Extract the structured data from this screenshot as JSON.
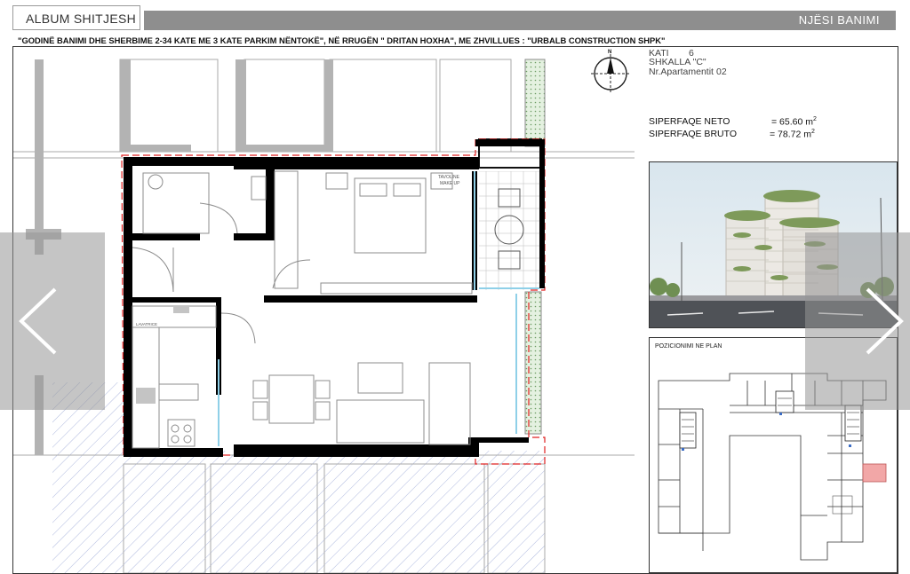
{
  "header": {
    "album_title": "ALBUM SHITJESH",
    "unit_title": "NJËSI BANIMI",
    "project_description": "\"GODINË BANIMI DHE SHERBIME 2-34 KATE  ME 3 KATE PARKIM NËNTOKË\", NË RRUGËN \" DRITAN HOXHA\", ME  ZHVILLUES : \"URBALB CONSTRUCTION SHPK\""
  },
  "apartment": {
    "floor_label": "KATI",
    "floor_value": "6",
    "stair_label": "SHKALLA \"C\"",
    "apartment_label": "Nr.Apartamentit",
    "apartment_value": "02"
  },
  "areas": {
    "net_label": "SIPERFAQE NETO",
    "net_value": "= 65.60 m",
    "gross_label": "SIPERFAQE BRUTO",
    "gross_value": "= 78.72 m",
    "unit_sup": "2"
  },
  "plan": {
    "compass_letter": "N",
    "tv_label_line1": "TAVOLINE",
    "tv_label_line2": "MAKE UP",
    "pantry_label": "LAVATRICE"
  },
  "keyplan": {
    "title": "POZICIONIMI NE PLAN"
  },
  "navigation": {
    "prev_icon": "chevron-left-icon",
    "next_icon": "chevron-right-icon"
  },
  "colors": {
    "header_bar": "#8e8e8e",
    "wall": "#000000",
    "highlight_unit": "#f2a7a7",
    "glazing": "#8fd0e8",
    "greenery": "#cfe7c8",
    "hatch": "#9aa7d6"
  }
}
